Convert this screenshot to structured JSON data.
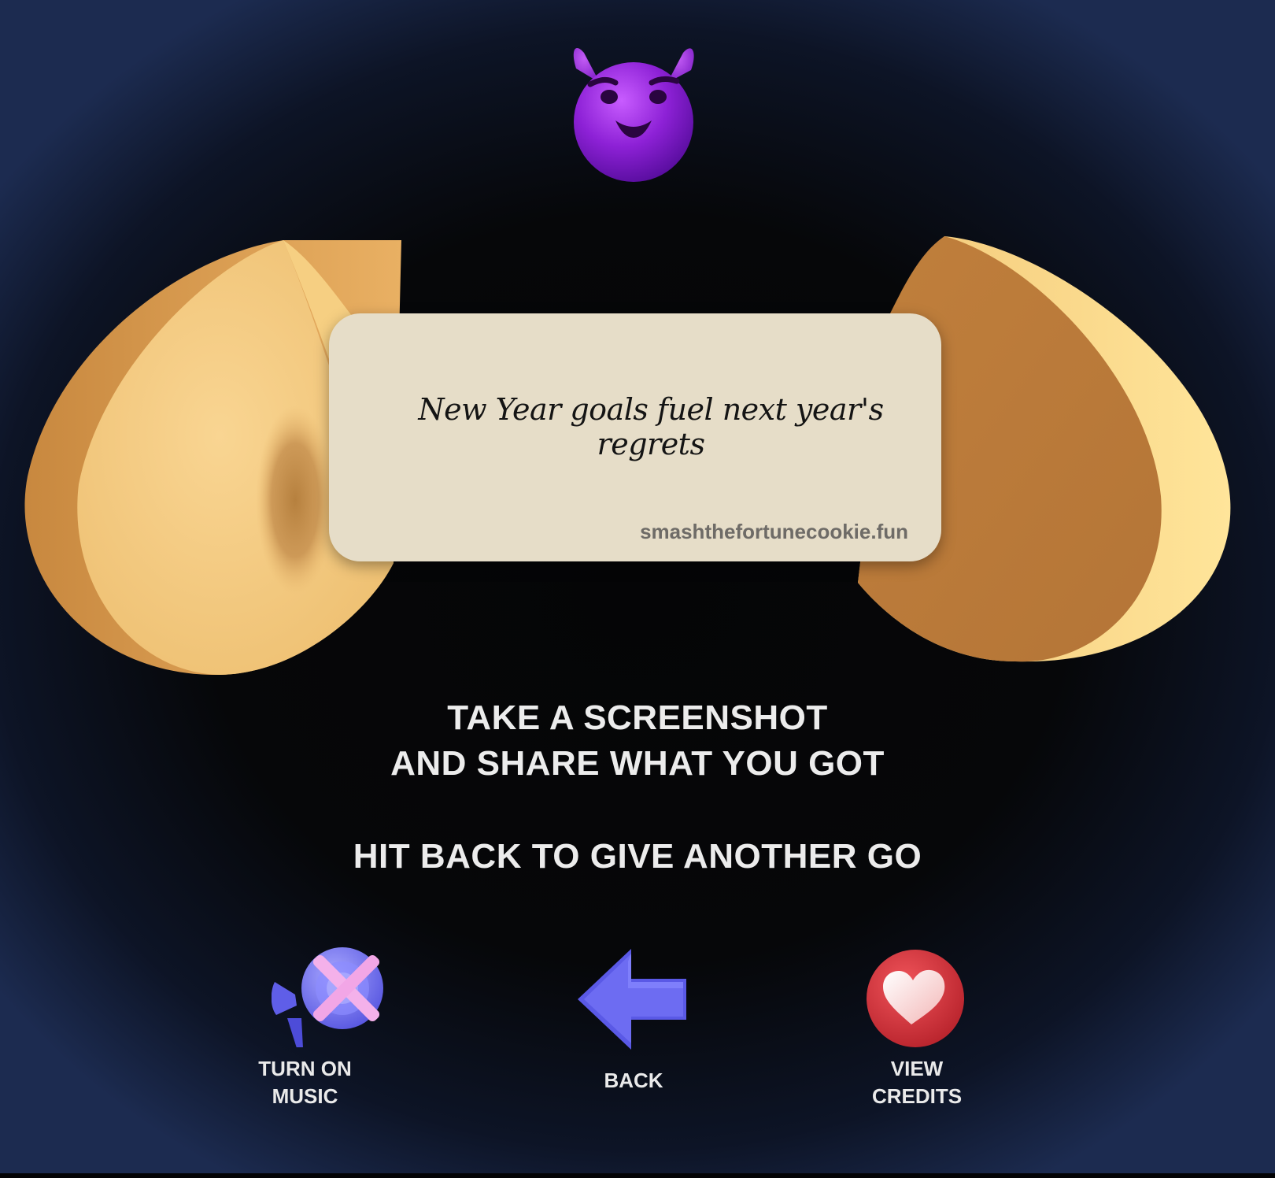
{
  "fortune": {
    "message": "New Year goals fuel next year's regrets",
    "website": "smashthefortunecookie.fun"
  },
  "instructions": {
    "line1": "TAKE A SCREENSHOT",
    "line2": "AND SHARE WHAT YOU GOT",
    "line3": "HIT BACK TO GIVE ANOTHER GO"
  },
  "controls": {
    "music": {
      "label_line1": "TURN ON",
      "label_line2": "MUSIC",
      "icon": "speaker-muted-icon"
    },
    "back": {
      "label": "BACK",
      "icon": "arrow-left-icon"
    },
    "credits": {
      "label_line1": "VIEW",
      "label_line2": "CREDITS",
      "icon": "heart-icon"
    }
  },
  "colors": {
    "paper": "#e6ddc8",
    "cookie": "#f1c679",
    "cookie_dark": "#b97c3c",
    "devil": "#9a2ee0",
    "back_arrow": "#6a6af0",
    "heart_bg": "#d7373f",
    "speaker": "#6d6cf0",
    "speaker_x": "#f2a6e6"
  }
}
